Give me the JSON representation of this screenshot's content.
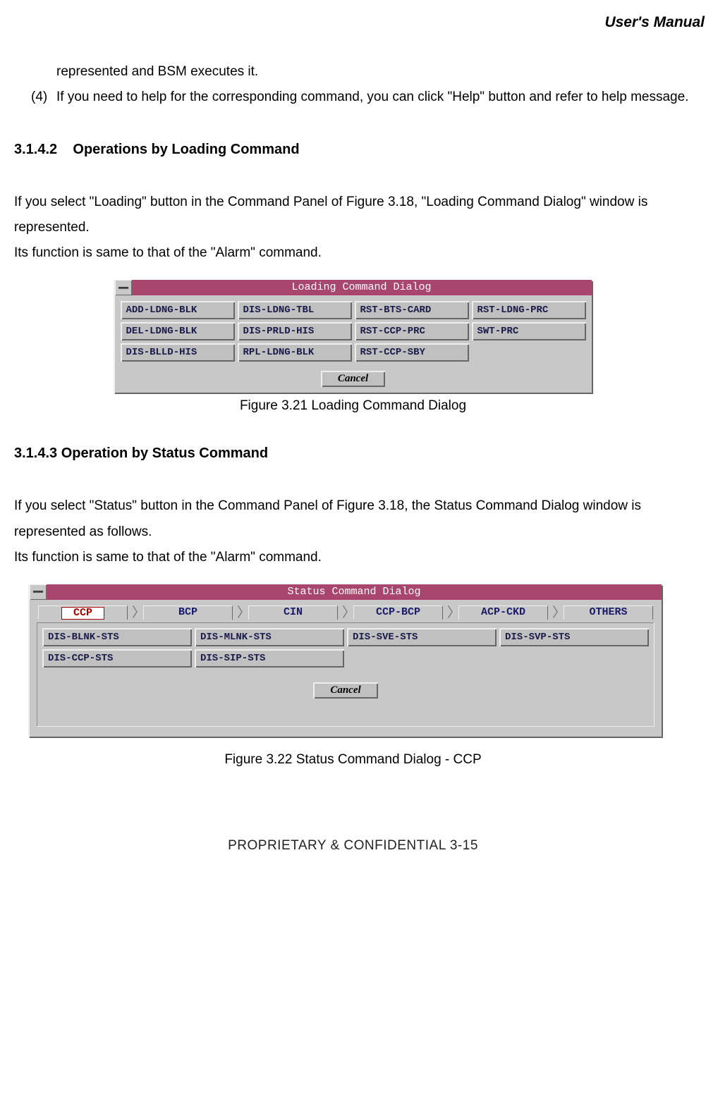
{
  "header": "User's Manual",
  "intro": {
    "line1": "represented and BSM executes it.",
    "item4_num": "(4)",
    "item4": "If you need to help for the corresponding command, you can click \"Help\" button and refer to help message."
  },
  "section1": {
    "num": "3.1.4.2",
    "title": "Operations by Loading Command",
    "para1": "If you select \"Loading\" button in the Command Panel of Figure 3.18, \"Loading Command Dialog\" window is represented.",
    "para2": "Its function is same to that of the \"Alarm\" command."
  },
  "loading_dialog": {
    "title": "Loading Command Dialog",
    "buttons": [
      [
        "ADD-LDNG-BLK",
        "DIS-LDNG-TBL",
        "RST-BTS-CARD",
        "RST-LDNG-PRC"
      ],
      [
        "DEL-LDNG-BLK",
        "DIS-PRLD-HIS",
        "RST-CCP-PRC",
        "SWT-PRC"
      ],
      [
        "DIS-BLLD-HIS",
        "RPL-LDNG-BLK",
        "RST-CCP-SBY",
        ""
      ]
    ],
    "cancel": "Cancel",
    "caption": "Figure 3.21  Loading Command Dialog"
  },
  "section2": {
    "heading": "3.1.4.3 Operation by Status Command",
    "para1": "If you select \"Status\" button in the Command Panel of Figure 3.18, the Status Command Dialog window is represented as follows.",
    "para2": "Its function is same to that of the \"Alarm\" command."
  },
  "status_dialog": {
    "title": "Status Command Dialog",
    "tabs": [
      "CCP",
      "BCP",
      "CIN",
      "CCP-BCP",
      "ACP-CKD",
      "OTHERS"
    ],
    "active_tab": 0,
    "buttons": [
      [
        "DIS-BLNK-STS",
        "DIS-MLNK-STS",
        "DIS-SVE-STS",
        "DIS-SVP-STS"
      ],
      [
        "DIS-CCP-STS",
        "DIS-SIP-STS",
        "",
        ""
      ]
    ],
    "cancel": "Cancel",
    "caption": "Figure 3.22 Status Command Dialog - CCP"
  },
  "footer": "PROPRIETARY & CONFIDENTIAL                 3-15"
}
